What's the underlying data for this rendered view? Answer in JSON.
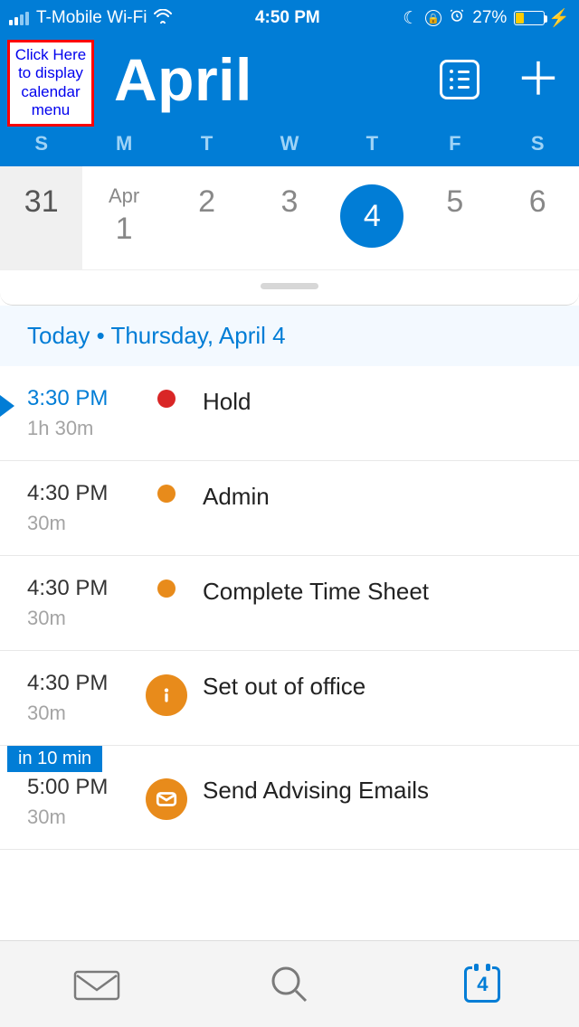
{
  "statusbar": {
    "carrier": "T-Mobile Wi-Fi",
    "time": "4:50 PM",
    "battery_pct": "27%"
  },
  "header": {
    "month": "April",
    "callout": "Click Here to display calendar menu"
  },
  "weekdays": [
    "S",
    "M",
    "T",
    "W",
    "T",
    "F",
    "S"
  ],
  "datestrip": {
    "prev": "31",
    "month_lbl": "Apr",
    "d1": "1",
    "d2": "2",
    "d3": "3",
    "d4": "4",
    "d5": "5",
    "d6": "6"
  },
  "today_banner": "Today • Thursday, April 4",
  "events": [
    {
      "time": "3:30 PM",
      "dur": "1h 30m",
      "title": "Hold",
      "color": "red",
      "now": true,
      "icon": "dot"
    },
    {
      "time": "4:30 PM",
      "dur": "30m",
      "title": "Admin",
      "color": "orange",
      "icon": "dot"
    },
    {
      "time": "4:30 PM",
      "dur": "30m",
      "title": "Complete Time Sheet",
      "color": "orange",
      "icon": "dot"
    },
    {
      "time": "4:30 PM",
      "dur": "30m",
      "title": "Set out of office",
      "color": "orange",
      "icon": "info"
    },
    {
      "time": "5:00 PM",
      "dur": "30m",
      "title": "Send Advising Emails",
      "color": "orange",
      "icon": "mail",
      "tag": "in 10 min"
    }
  ],
  "tabbar": {
    "cal_day": "4"
  }
}
